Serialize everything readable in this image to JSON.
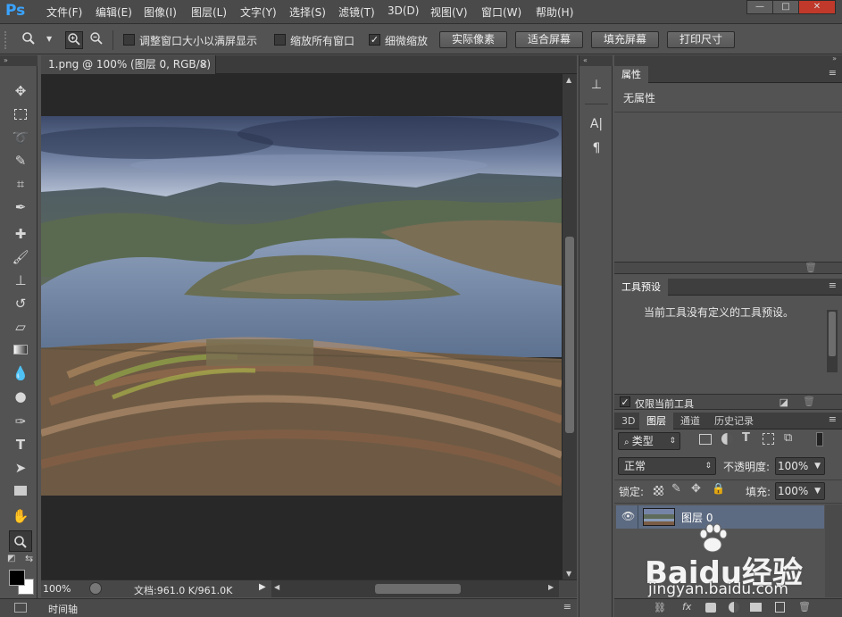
{
  "app": {
    "logo": "Ps",
    "menu": [
      "文件(F)",
      "编辑(E)",
      "图像(I)",
      "图层(L)",
      "文字(Y)",
      "选择(S)",
      "滤镜(T)",
      "3D(D)",
      "视图(V)",
      "窗口(W)",
      "帮助(H)"
    ],
    "window_buttons": [
      "—",
      "□",
      "✕"
    ]
  },
  "options_bar": {
    "tool_icon": "zoom-icon",
    "resize_windows_label": "调整窗口大小以满屏显示",
    "resize_windows_checked": false,
    "zoom_all_label": "缩放所有窗口",
    "zoom_all_checked": false,
    "scrubby_zoom_label": "细微缩放",
    "scrubby_zoom_checked": true,
    "actual_pixels": "实际像素",
    "fit_screen": "适合屏幕",
    "fill_screen": "填充屏幕",
    "print_size": "打印尺寸"
  },
  "tools": [
    "move-icon",
    "marquee-icon",
    "lasso-icon",
    "quick-select-icon",
    "crop-icon",
    "eyedropper-icon",
    "healing-icon",
    "brush-icon",
    "stamp-icon",
    "history-brush-icon",
    "eraser-icon",
    "gradient-icon",
    "blur-icon",
    "dodge-icon",
    "pen-icon",
    "type-icon",
    "path-select-icon",
    "rectangle-icon",
    "hand-icon",
    "zoom-icon"
  ],
  "document": {
    "tab_title": "1.png @ 100% (图层 0, RGB/8)",
    "tab_close": "×",
    "zoom": "100%",
    "doc_info": "文档:961.0 K/961.0K",
    "timeline_label": "时间轴"
  },
  "properties_panel": {
    "tab": "属性",
    "content": "无属性"
  },
  "tool_presets_panel": {
    "tab": "工具预设",
    "content": "当前工具没有定义的工具预设。",
    "current_tool_only": "仅限当前工具",
    "current_tool_only_checked": true
  },
  "layers_panel": {
    "tabs": [
      "3D",
      "图层",
      "通道",
      "历史记录"
    ],
    "active_tab": "图层",
    "filter_kind": "类型",
    "blend_mode": "正常",
    "opacity_label": "不透明度:",
    "opacity_value": "100%",
    "lock_label": "锁定:",
    "fill_label": "填充:",
    "fill_value": "100%",
    "layers": [
      {
        "name": "图层 0",
        "visible": true,
        "selected": true
      }
    ]
  },
  "watermark": {
    "brand": "Baidu经验",
    "url": "jingyan.baidu.com"
  },
  "colors": {
    "accent": "#3aa3ff",
    "selected_layer": "#5d6b82",
    "foreground": "#000000",
    "background": "#ffffff"
  }
}
